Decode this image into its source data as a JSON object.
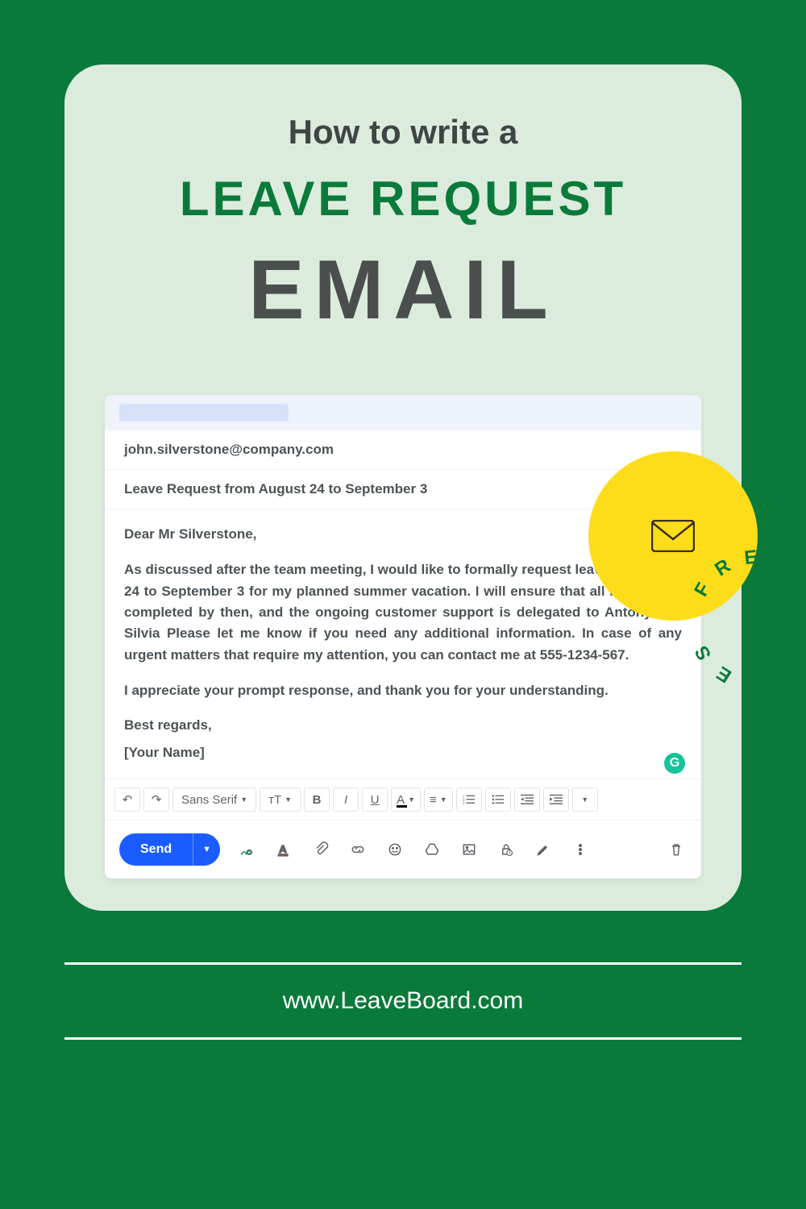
{
  "headings": {
    "line1": "How to write a",
    "line2": "LEAVE REQUEST",
    "line3": "EMAIL"
  },
  "badge": {
    "text": "FREE SAMPLES"
  },
  "email": {
    "to": "john.silverstone@company.com",
    "subject": "Leave Request from August 24 to September 3",
    "greeting": "Dear Mr Silverstone,",
    "body": "As discussed after the team meeting, I would like to formally request leave for August 24 to September 3 for my planned summer vacation. I will ensure that all my work is completed by then, and the ongoing customer support is delegated to Antony and Silvia Please let me know if you need any additional information. In case of any urgent matters that require my attention, you can contact me at 555-1234-567.",
    "closing": "I appreciate your prompt response, and thank you for your understanding.",
    "signoff1": "Best regards,",
    "signoff2": "[Your Name]"
  },
  "grammarly_letter": "G",
  "toolbar": {
    "font": "Sans Serif",
    "size_label": "тT",
    "bold": "B",
    "italic": "I",
    "underline": "U",
    "textcolor": "A"
  },
  "send_label": "Send",
  "website": "www.LeaveBoard.com"
}
